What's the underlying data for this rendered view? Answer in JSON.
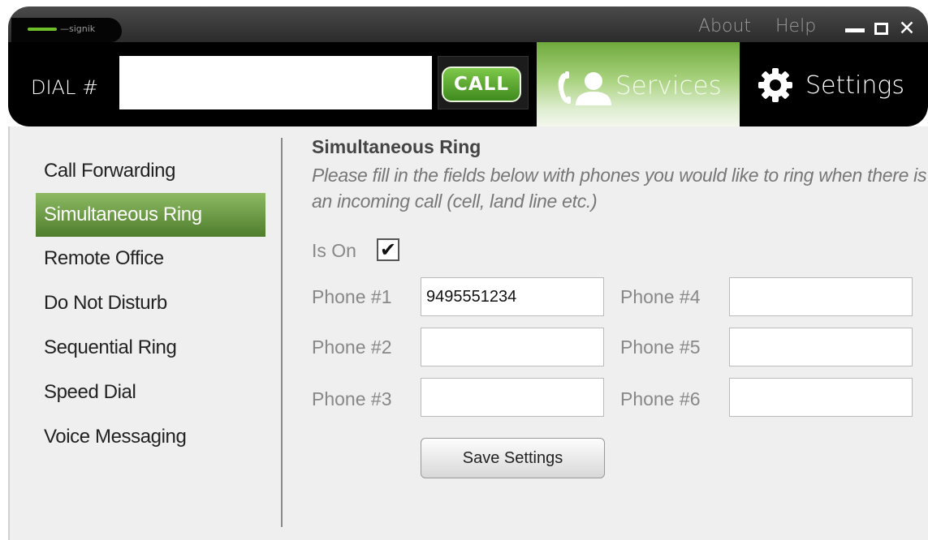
{
  "titlebar": {
    "logo_text": "—signik",
    "links": [
      "About",
      "Help"
    ]
  },
  "toolbar": {
    "dial_label": "DIAL #",
    "dial_value": "",
    "call_label": "CALL",
    "services_label": "Services",
    "settings_label": "Settings"
  },
  "sidebar": {
    "items": [
      {
        "label": "Call Forwarding",
        "active": false
      },
      {
        "label": "Simultaneous Ring",
        "active": true
      },
      {
        "label": "Remote Office",
        "active": false
      },
      {
        "label": "Do Not Disturb",
        "active": false
      },
      {
        "label": "Sequential Ring",
        "active": false
      },
      {
        "label": "Speed Dial",
        "active": false
      },
      {
        "label": "Voice Messaging",
        "active": false
      }
    ]
  },
  "panel": {
    "title": "Simultaneous Ring",
    "description": "Please fill in the fields below with phones you would like to ring when there is an incoming call (cell, land line etc.)",
    "is_on_label": "Is On",
    "is_on_checked": true,
    "checkmark": "✔",
    "phones": [
      {
        "label": "Phone #1",
        "value": "9495551234"
      },
      {
        "label": "Phone #2",
        "value": ""
      },
      {
        "label": "Phone #3",
        "value": ""
      },
      {
        "label": "Phone #4",
        "value": ""
      },
      {
        "label": "Phone #5",
        "value": ""
      },
      {
        "label": "Phone #6",
        "value": ""
      }
    ],
    "save_label": "Save Settings"
  },
  "colors": {
    "accent_green": "#4e7d2c",
    "call_green": "#5aa832",
    "toolbar_black": "#000000"
  }
}
